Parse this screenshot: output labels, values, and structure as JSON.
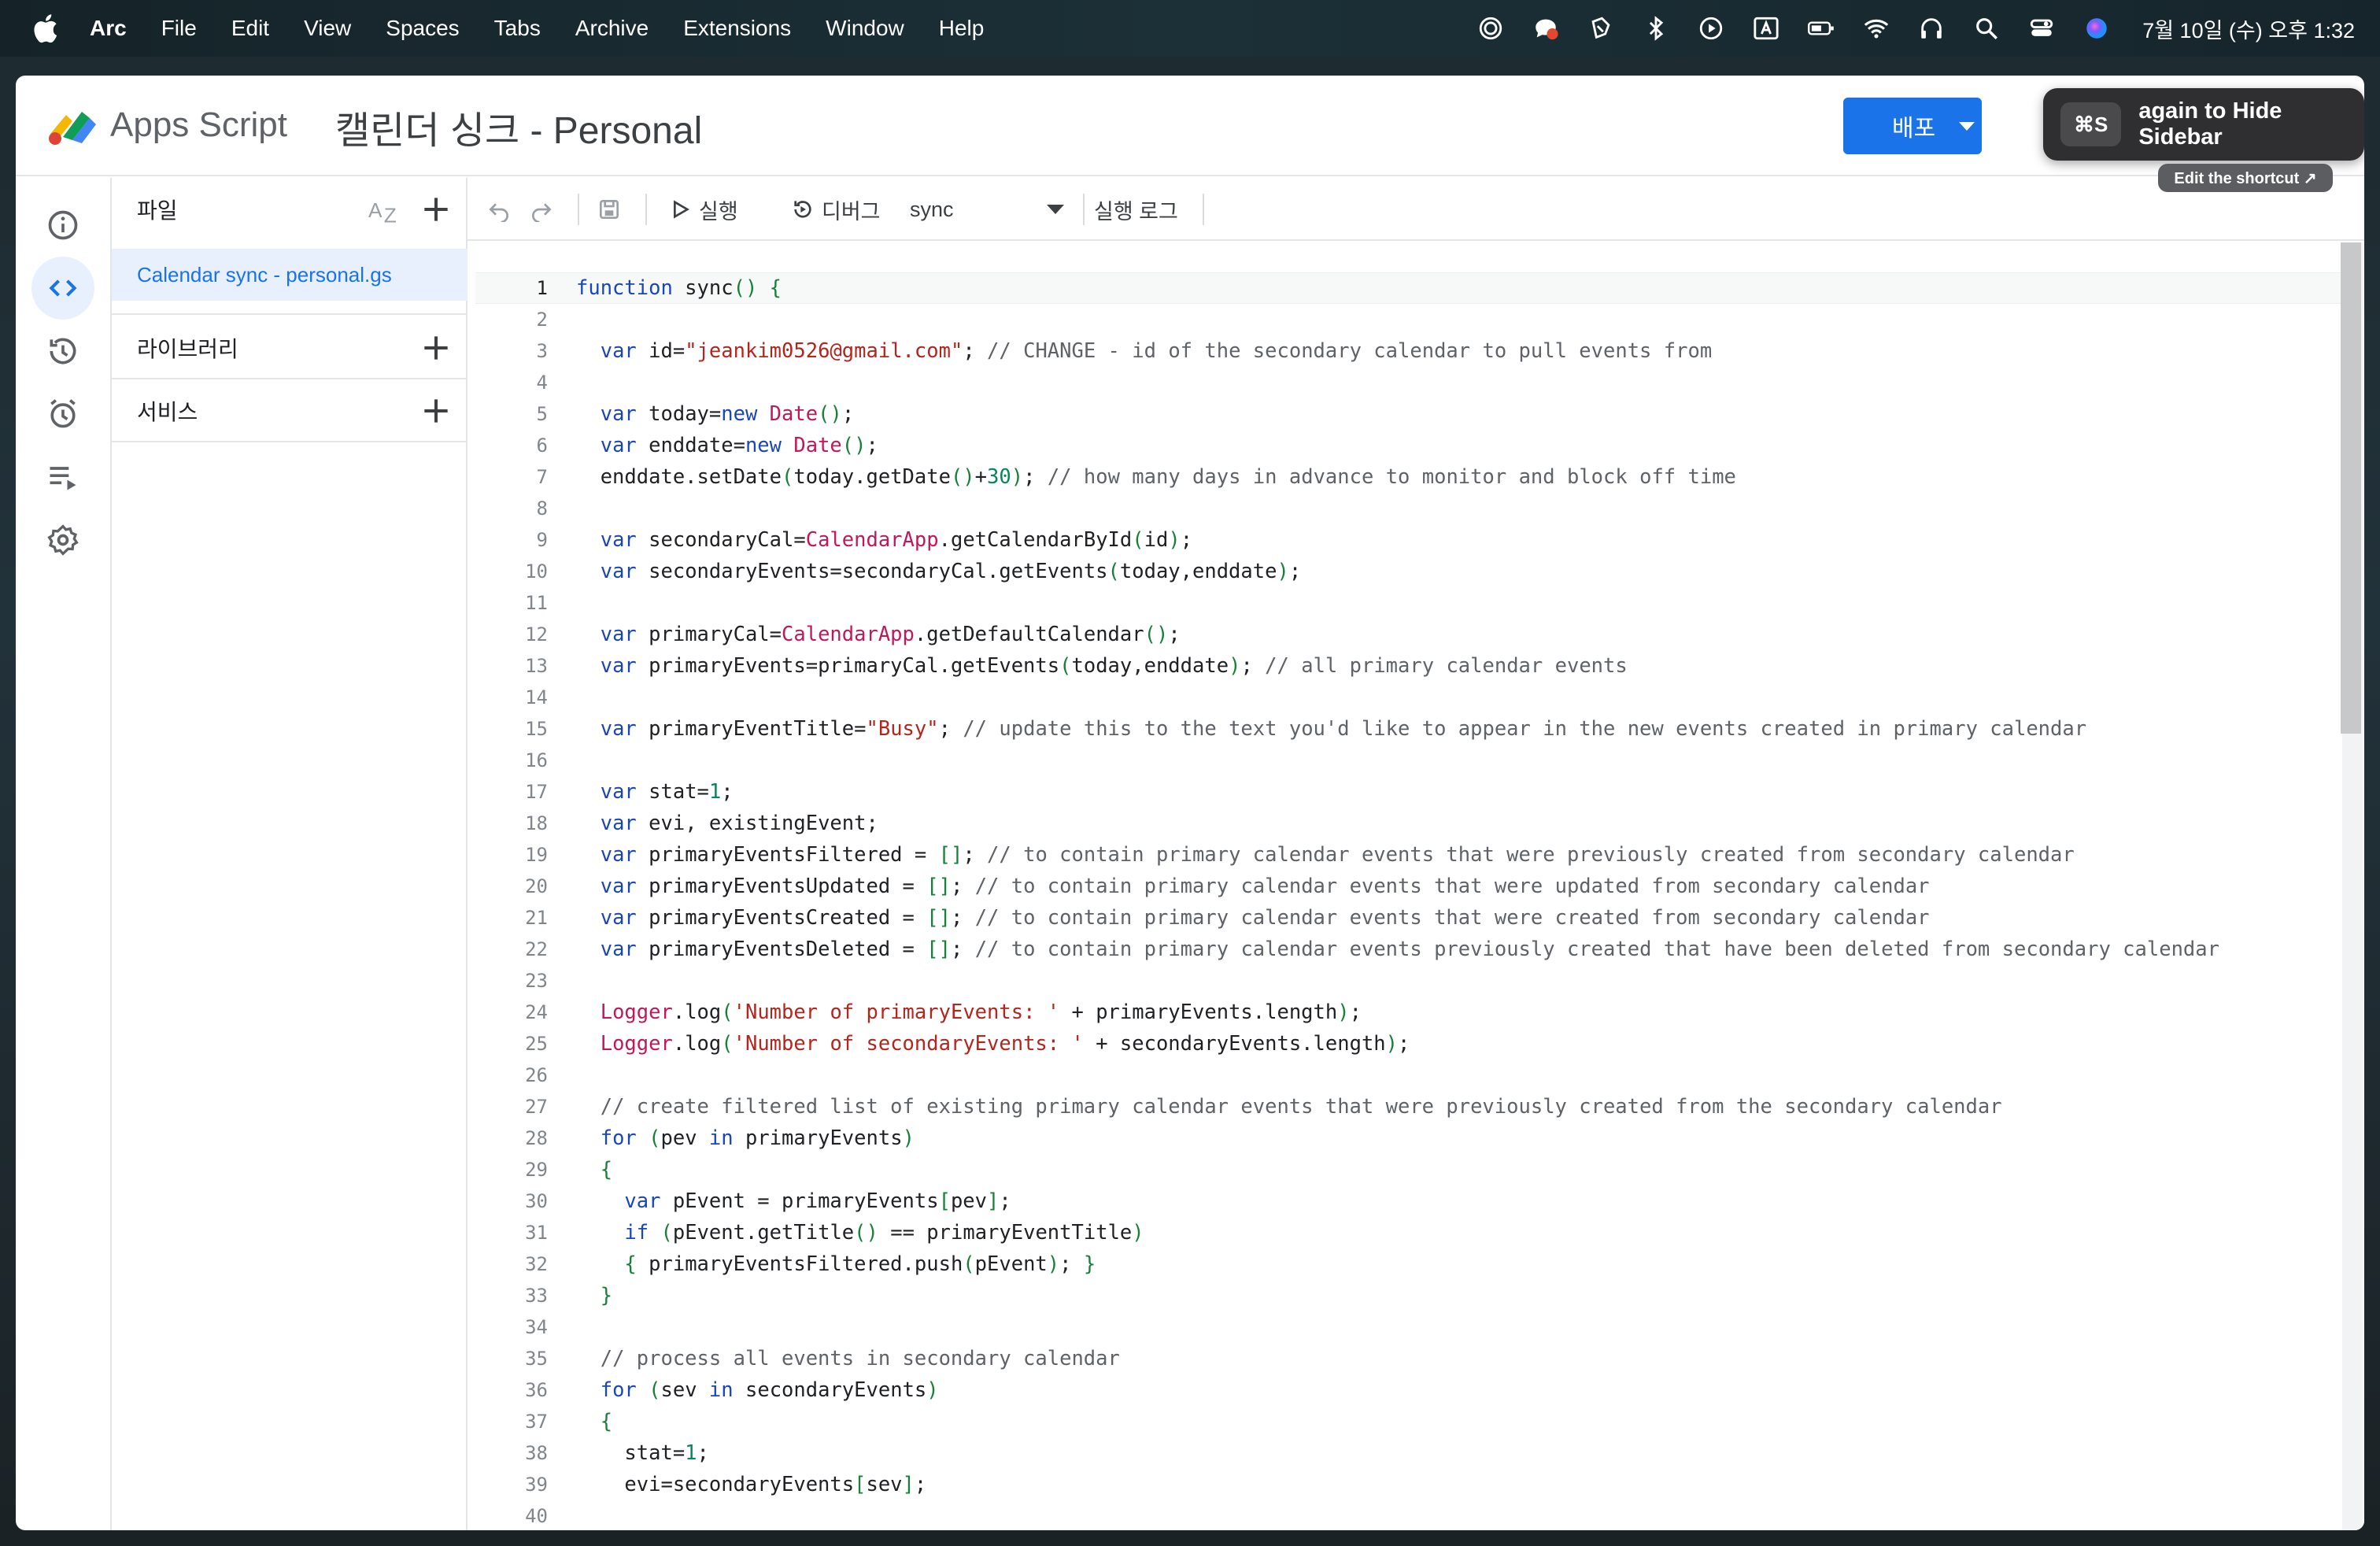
{
  "menubar": {
    "app_name": "Arc",
    "items": [
      "File",
      "Edit",
      "View",
      "Spaces",
      "Tabs",
      "Archive",
      "Extensions",
      "Window",
      "Help"
    ],
    "clock": "7월 10일 (수) 오후 1:32",
    "status_icons": [
      "focus-icon",
      "chat-notification-icon",
      "script-icon",
      "bluetooth-icon",
      "play-icon",
      "input-source-icon",
      "battery-icon",
      "wifi-icon",
      "headphones-icon",
      "spotlight-search-icon",
      "control-center-icon",
      "siri-icon"
    ]
  },
  "header": {
    "brand": "Apps Script",
    "project_title": "캘린더 싱크 - Personal",
    "deploy_label": "배포",
    "accent": "#1a73e8"
  },
  "arc_toast": {
    "shortcut": "⌘S",
    "message": "again to Hide Sidebar",
    "edit_label": "Edit the shortcut ↗"
  },
  "rail": [
    "info-icon",
    "code-icon",
    "history-icon",
    "alarm-icon",
    "executions-icon",
    "settings-icon"
  ],
  "files_panel": {
    "files_title": "파일",
    "sort_label": "AZ",
    "active_file": "Calendar sync - personal.gs",
    "libraries_title": "라이브러리",
    "services_title": "서비스"
  },
  "toolbar": {
    "run_label": "실행",
    "debug_label": "디버그",
    "function_select": "sync",
    "log_label": "실행 로그"
  },
  "code": {
    "current_line": 1,
    "lines": [
      [
        [
          "kw",
          "function"
        ],
        [
          "t",
          " sync"
        ],
        [
          "pun",
          "()"
        ],
        [
          "t",
          " "
        ],
        [
          "pun",
          "{"
        ]
      ],
      [],
      [
        [
          "t",
          "  "
        ],
        [
          "kw",
          "var"
        ],
        [
          "t",
          " id="
        ],
        [
          "str",
          "\"jeankim0526@gmail.com\""
        ],
        [
          "t",
          "; "
        ],
        [
          "cmt",
          "// CHANGE - id of the secondary calendar to pull events from"
        ]
      ],
      [],
      [
        [
          "t",
          "  "
        ],
        [
          "kw",
          "var"
        ],
        [
          "t",
          " today="
        ],
        [
          "kw",
          "new"
        ],
        [
          "t",
          " "
        ],
        [
          "cls",
          "Date"
        ],
        [
          "pun",
          "()"
        ],
        [
          "t",
          ";"
        ]
      ],
      [
        [
          "t",
          "  "
        ],
        [
          "kw",
          "var"
        ],
        [
          "t",
          " enddate="
        ],
        [
          "kw",
          "new"
        ],
        [
          "t",
          " "
        ],
        [
          "cls",
          "Date"
        ],
        [
          "pun",
          "()"
        ],
        [
          "t",
          ";"
        ]
      ],
      [
        [
          "t",
          "  enddate.setDate"
        ],
        [
          "pun",
          "("
        ],
        [
          "t",
          "today.getDate"
        ],
        [
          "pun",
          "()"
        ],
        [
          "t",
          "+"
        ],
        [
          "num",
          "30"
        ],
        [
          "pun",
          ")"
        ],
        [
          "t",
          "; "
        ],
        [
          "cmt",
          "// how many days in advance to monitor and block off time"
        ]
      ],
      [],
      [
        [
          "t",
          "  "
        ],
        [
          "kw",
          "var"
        ],
        [
          "t",
          " secondaryCal="
        ],
        [
          "cls",
          "CalendarApp"
        ],
        [
          "t",
          ".getCalendarById"
        ],
        [
          "pun",
          "("
        ],
        [
          "t",
          "id"
        ],
        [
          "pun",
          ")"
        ],
        [
          "t",
          ";"
        ]
      ],
      [
        [
          "t",
          "  "
        ],
        [
          "kw",
          "var"
        ],
        [
          "t",
          " secondaryEvents=secondaryCal.getEvents"
        ],
        [
          "pun",
          "("
        ],
        [
          "t",
          "today,enddate"
        ],
        [
          "pun",
          ")"
        ],
        [
          "t",
          ";"
        ]
      ],
      [],
      [
        [
          "t",
          "  "
        ],
        [
          "kw",
          "var"
        ],
        [
          "t",
          " primaryCal="
        ],
        [
          "cls",
          "CalendarApp"
        ],
        [
          "t",
          ".getDefaultCalendar"
        ],
        [
          "pun",
          "()"
        ],
        [
          "t",
          ";"
        ]
      ],
      [
        [
          "t",
          "  "
        ],
        [
          "kw",
          "var"
        ],
        [
          "t",
          " primaryEvents=primaryCal.getEvents"
        ],
        [
          "pun",
          "("
        ],
        [
          "t",
          "today,enddate"
        ],
        [
          "pun",
          ")"
        ],
        [
          "t",
          "; "
        ],
        [
          "cmt",
          "// all primary calendar events"
        ]
      ],
      [],
      [
        [
          "t",
          "  "
        ],
        [
          "kw",
          "var"
        ],
        [
          "t",
          " primaryEventTitle="
        ],
        [
          "str",
          "\"Busy\""
        ],
        [
          "t",
          "; "
        ],
        [
          "cmt",
          "// update this to the text you'd like to appear in the new events created in primary calendar"
        ]
      ],
      [],
      [
        [
          "t",
          "  "
        ],
        [
          "kw",
          "var"
        ],
        [
          "t",
          " stat="
        ],
        [
          "num",
          "1"
        ],
        [
          "t",
          ";"
        ]
      ],
      [
        [
          "t",
          "  "
        ],
        [
          "kw",
          "var"
        ],
        [
          "t",
          " evi, existingEvent;"
        ]
      ],
      [
        [
          "t",
          "  "
        ],
        [
          "kw",
          "var"
        ],
        [
          "t",
          " primaryEventsFiltered = "
        ],
        [
          "pun",
          "[]"
        ],
        [
          "t",
          "; "
        ],
        [
          "cmt",
          "// to contain primary calendar events that were previously created from secondary calendar"
        ]
      ],
      [
        [
          "t",
          "  "
        ],
        [
          "kw",
          "var"
        ],
        [
          "t",
          " primaryEventsUpdated = "
        ],
        [
          "pun",
          "[]"
        ],
        [
          "t",
          "; "
        ],
        [
          "cmt",
          "// to contain primary calendar events that were updated from secondary calendar"
        ]
      ],
      [
        [
          "t",
          "  "
        ],
        [
          "kw",
          "var"
        ],
        [
          "t",
          " primaryEventsCreated = "
        ],
        [
          "pun",
          "[]"
        ],
        [
          "t",
          "; "
        ],
        [
          "cmt",
          "// to contain primary calendar events that were created from secondary calendar"
        ]
      ],
      [
        [
          "t",
          "  "
        ],
        [
          "kw",
          "var"
        ],
        [
          "t",
          " primaryEventsDeleted = "
        ],
        [
          "pun",
          "[]"
        ],
        [
          "t",
          "; "
        ],
        [
          "cmt",
          "// to contain primary calendar events previously created that have been deleted from secondary calendar"
        ]
      ],
      [],
      [
        [
          "t",
          "  "
        ],
        [
          "cls",
          "Logger"
        ],
        [
          "t",
          ".log"
        ],
        [
          "pun",
          "("
        ],
        [
          "str",
          "'Number of primaryEvents: '"
        ],
        [
          "t",
          " + primaryEvents.length"
        ],
        [
          "pun",
          ")"
        ],
        [
          "t",
          ";"
        ]
      ],
      [
        [
          "t",
          "  "
        ],
        [
          "cls",
          "Logger"
        ],
        [
          "t",
          ".log"
        ],
        [
          "pun",
          "("
        ],
        [
          "str",
          "'Number of secondaryEvents: '"
        ],
        [
          "t",
          " + secondaryEvents.length"
        ],
        [
          "pun",
          ")"
        ],
        [
          "t",
          ";"
        ]
      ],
      [],
      [
        [
          "t",
          "  "
        ],
        [
          "cmt",
          "// create filtered list of existing primary calendar events that were previously created from the secondary calendar"
        ]
      ],
      [
        [
          "t",
          "  "
        ],
        [
          "kw",
          "for"
        ],
        [
          "t",
          " "
        ],
        [
          "pun",
          "("
        ],
        [
          "t",
          "pev "
        ],
        [
          "kw",
          "in"
        ],
        [
          "t",
          " primaryEvents"
        ],
        [
          "pun",
          ")"
        ]
      ],
      [
        [
          "t",
          "  "
        ],
        [
          "pun",
          "{"
        ]
      ],
      [
        [
          "t",
          "    "
        ],
        [
          "kw",
          "var"
        ],
        [
          "t",
          " pEvent = primaryEvents"
        ],
        [
          "pun",
          "["
        ],
        [
          "t",
          "pev"
        ],
        [
          "pun",
          "]"
        ],
        [
          "t",
          ";"
        ]
      ],
      [
        [
          "t",
          "    "
        ],
        [
          "kw",
          "if"
        ],
        [
          "t",
          " "
        ],
        [
          "pun",
          "("
        ],
        [
          "t",
          "pEvent.getTitle"
        ],
        [
          "pun",
          "()"
        ],
        [
          "t",
          " == primaryEventTitle"
        ],
        [
          "pun",
          ")"
        ]
      ],
      [
        [
          "t",
          "    "
        ],
        [
          "pun",
          "{"
        ],
        [
          "t",
          " primaryEventsFiltered.push"
        ],
        [
          "pun",
          "("
        ],
        [
          "t",
          "pEvent"
        ],
        [
          "pun",
          ")"
        ],
        [
          "t",
          "; "
        ],
        [
          "pun",
          "}"
        ]
      ],
      [
        [
          "t",
          "  "
        ],
        [
          "pun",
          "}"
        ]
      ],
      [],
      [
        [
          "t",
          "  "
        ],
        [
          "cmt",
          "// process all events in secondary calendar"
        ]
      ],
      [
        [
          "t",
          "  "
        ],
        [
          "kw",
          "for"
        ],
        [
          "t",
          " "
        ],
        [
          "pun",
          "("
        ],
        [
          "t",
          "sev "
        ],
        [
          "kw",
          "in"
        ],
        [
          "t",
          " secondaryEvents"
        ],
        [
          "pun",
          ")"
        ]
      ],
      [
        [
          "t",
          "  "
        ],
        [
          "pun",
          "{"
        ]
      ],
      [
        [
          "t",
          "    stat="
        ],
        [
          "num",
          "1"
        ],
        [
          "t",
          ";"
        ]
      ],
      [
        [
          "t",
          "    evi=secondaryEvents"
        ],
        [
          "pun",
          "["
        ],
        [
          "t",
          "sev"
        ],
        [
          "pun",
          "]"
        ],
        [
          "t",
          ";"
        ]
      ],
      []
    ]
  }
}
